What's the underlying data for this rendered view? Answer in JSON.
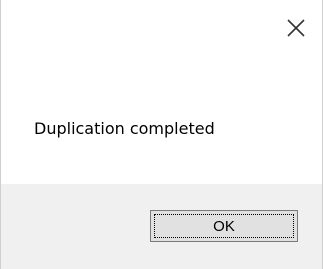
{
  "dialog": {
    "close_icon": "close-icon",
    "message": "Duplication completed",
    "ok_label": "OK"
  },
  "colors": {
    "body_bg": "#ffffff",
    "footer_bg": "#f0f0f0",
    "button_bg": "#e1e1e1"
  }
}
